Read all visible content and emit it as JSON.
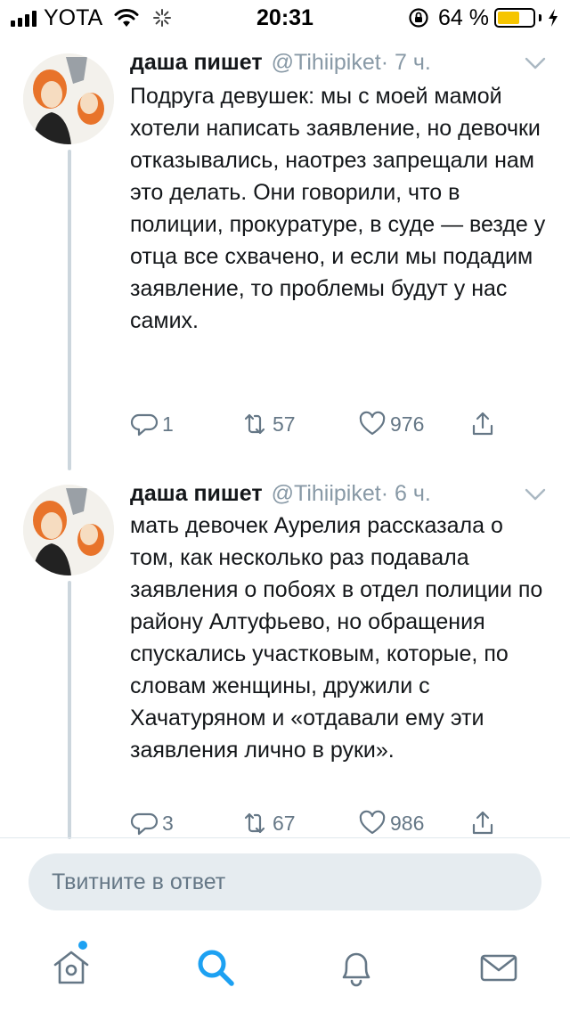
{
  "status_bar": {
    "carrier": "YOTA",
    "time": "20:31",
    "battery_percent": "64 %",
    "battery_level": 0.64,
    "icons": [
      "signal-icon",
      "wifi-icon",
      "spinner-icon",
      "orientation-lock-icon",
      "battery-icon",
      "charging-bolt-icon"
    ]
  },
  "tweets": [
    {
      "author": "даша пишет",
      "handle": "@Tihiipiket",
      "time": " · 7 ч.",
      "text": "Подруга девушек: мы с моей мамой хотели написать заявление, но девочки отказывались, наотрез запрещали нам это делать. Они говорили, что в полиции, прокуратуре, в суде — везде у отца все схвачено, и если мы подадим заявление, то проблемы будут у нас самих.",
      "replies": "1",
      "retweets": "57",
      "likes": "976"
    },
    {
      "author": "даша пишет",
      "handle": "@Tihiipiket",
      "time": " · 6 ч.",
      "text": "мать девочек Аурелия рассказала о том, как несколько раз подавала заявления о побоях в отдел полиции по району Алтуфьево, но обращения спускались участковым, которые, по словам женщины, дружили с Хачатуряном и «отдавали ему эти заявления лично в руки».",
      "replies": "3",
      "retweets": "67",
      "likes": "986"
    }
  ],
  "reply_box": {
    "placeholder": "Твитните в ответ"
  },
  "tab_bar": {
    "tabs": [
      "home-icon",
      "search-icon",
      "notifications-icon",
      "messages-icon"
    ],
    "active": "search-icon"
  },
  "colors": {
    "accent": "#1da1f2",
    "secondary_text": "#657786",
    "handle_text": "#8899a6",
    "thread_line": "#ccd6dd",
    "battery_fill": "#f6c500"
  }
}
